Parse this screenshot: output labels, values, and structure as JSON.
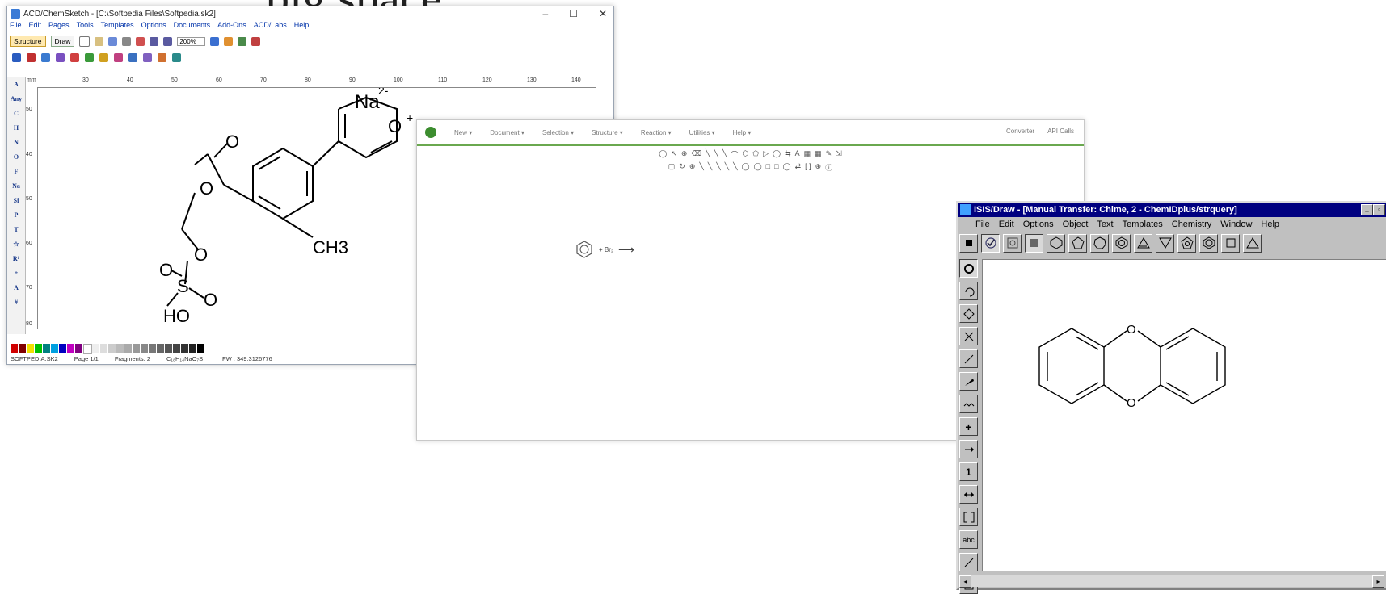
{
  "background_text": ", big space, ",
  "acd": {
    "title": "ACD/ChemSketch - [C:\\Softpedia Files\\Softpedia.sk2]",
    "window_controls": [
      "–",
      "☐",
      "✕"
    ],
    "menu": [
      "File",
      "Edit",
      "Pages",
      "Tools",
      "Templates",
      "Options",
      "Documents",
      "Add-Ons",
      "ACD/Labs",
      "Help"
    ],
    "mode_tabs": [
      "Structure",
      "Draw"
    ],
    "zoom": "200%",
    "ruler_ticks": [
      "30",
      "40",
      "50",
      "60",
      "70",
      "80",
      "90",
      "100",
      "110",
      "120",
      "130",
      "140"
    ],
    "ruler_unit": "mm",
    "vruler_ticks": [
      "50",
      "40",
      "50",
      "60",
      "70",
      "80"
    ],
    "left_tools": [
      "A",
      "Any",
      "C",
      "H",
      "N",
      "O",
      "F",
      "Na",
      "Si",
      "P",
      "T",
      "☆",
      "R¹",
      "+",
      "A",
      "#"
    ],
    "molecule_labels": {
      "na": "Na",
      "charge_na": "2-",
      "o_plus": "O",
      "plus": "+",
      "o_ald": "O",
      "o_ester": "O",
      "o_link": "O",
      "o_s1": "O",
      "s": "S",
      "o_s2": "O",
      "ho": "HO",
      "ch3": "CH3"
    },
    "status": {
      "file": "SOFTPEDIA.SK2",
      "page": "Page 1/1",
      "fragments": "Fragments: 2",
      "formula": "C₁₈H₁₄NaO₇S⁻",
      "fw": "FW : 349.3126776"
    }
  },
  "web": {
    "menu": [
      "New ▾",
      "Document ▾",
      "Selection ▾",
      "Structure ▾",
      "Reaction ▾",
      "Utilities ▾",
      "Help ▾"
    ],
    "right_links": [
      "Converter",
      "API Calls"
    ],
    "reaction": {
      "reagent": "+ Br₂",
      "arrow": "⟶"
    }
  },
  "isis": {
    "title": "ISIS/Draw - [Manual Transfer: Chime, 2 - ChemIDplus/strquery]",
    "menu": [
      "File",
      "Edit",
      "Options",
      "Object",
      "Text",
      "Templates",
      "Chemistry",
      "Window",
      "Help"
    ],
    "molecule_labels": {
      "o_top": "O",
      "o_bottom": "O"
    },
    "side_tool_labels": {
      "plus": "+",
      "one": "1",
      "abc": "abc"
    }
  },
  "colors": {
    "acd_menu": "#0033aa",
    "web_accent": "#6aa84f",
    "isis_title": "#000080"
  }
}
